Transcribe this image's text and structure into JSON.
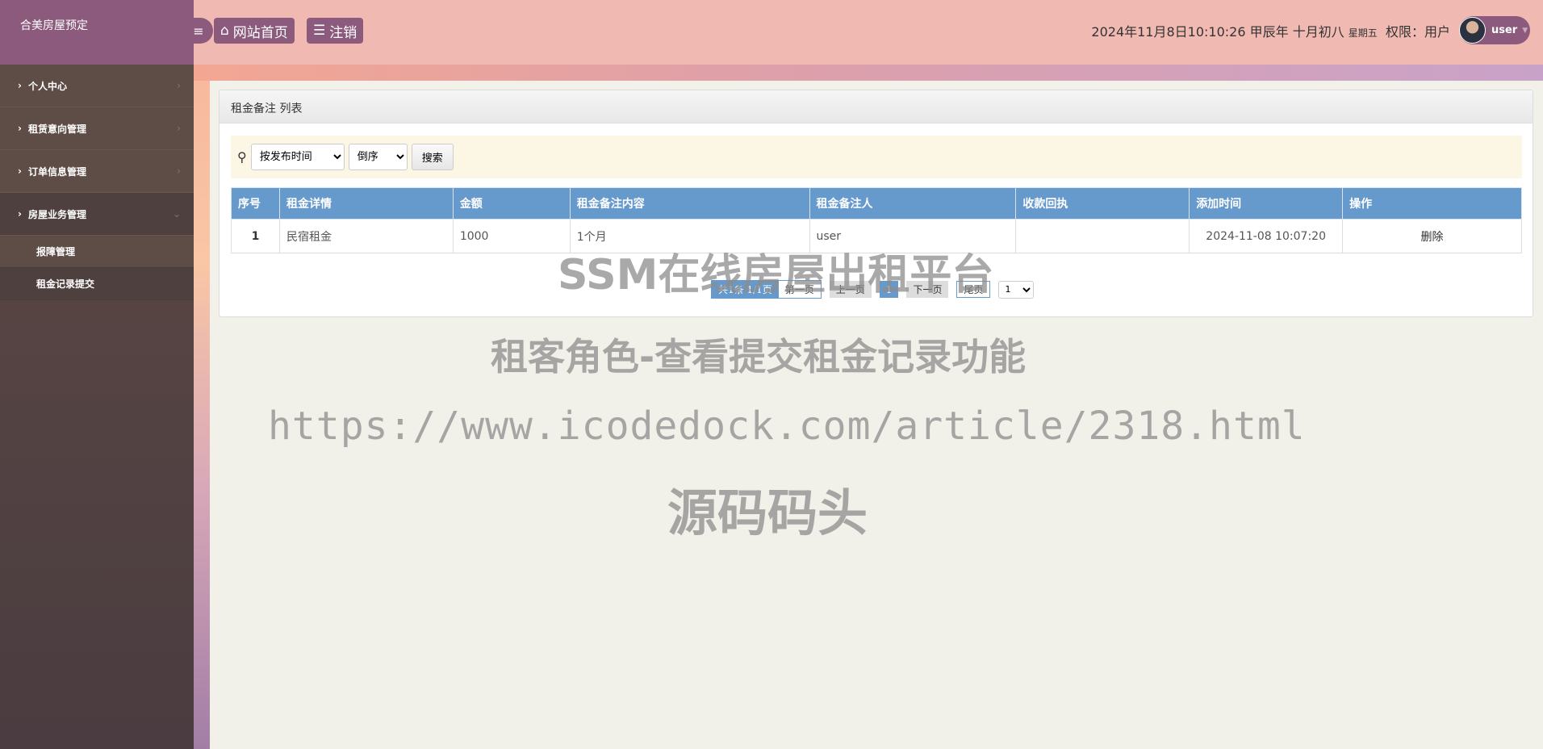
{
  "brand": "合美房屋预定",
  "sidebar": {
    "items": [
      {
        "label": "个人中心"
      },
      {
        "label": "租赁意向管理"
      },
      {
        "label": "订单信息管理"
      },
      {
        "label": "房屋业务管理",
        "expanded": true
      }
    ],
    "subitems": [
      {
        "label": "报障管理"
      },
      {
        "label": "租金记录提交"
      }
    ]
  },
  "header": {
    "home_label": "网站首页",
    "logout_label": "注销",
    "datetime": "2024年11月8日10:10:26 甲辰年 十月初八",
    "weekday": "星期五",
    "permission": "权限：用户",
    "username": "user"
  },
  "panel": {
    "title": "租金备注 列表",
    "search": {
      "sort_field": "按发布时间",
      "sort_order": "倒序",
      "button": "搜索"
    },
    "columns": [
      "序号",
      "租金详情",
      "金额",
      "租金备注内容",
      "租金备注人",
      "收款回执",
      "添加时间",
      "操作"
    ],
    "rows": [
      {
        "index": "1",
        "detail": "民宿租金",
        "amount": "1000",
        "content": "1个月",
        "person": "user",
        "receipt": "",
        "time": "2024-11-08 10:07:20",
        "action": "删除"
      }
    ],
    "pager": {
      "summary": "共1条  1/1页",
      "first": "第一页",
      "prev": "上一页",
      "current": "1",
      "next": "下一页",
      "last": "尾页",
      "select": "1"
    }
  },
  "watermark": {
    "line1": "SSM在线房屋出租平台",
    "line2": "租客角色-查看提交租金记录功能",
    "line3": "https://www.icodedock.com/article/2318.html",
    "line4": "源码码头"
  },
  "colors": {
    "accent": "#8b5a7c",
    "table_header": "#6699cc"
  }
}
